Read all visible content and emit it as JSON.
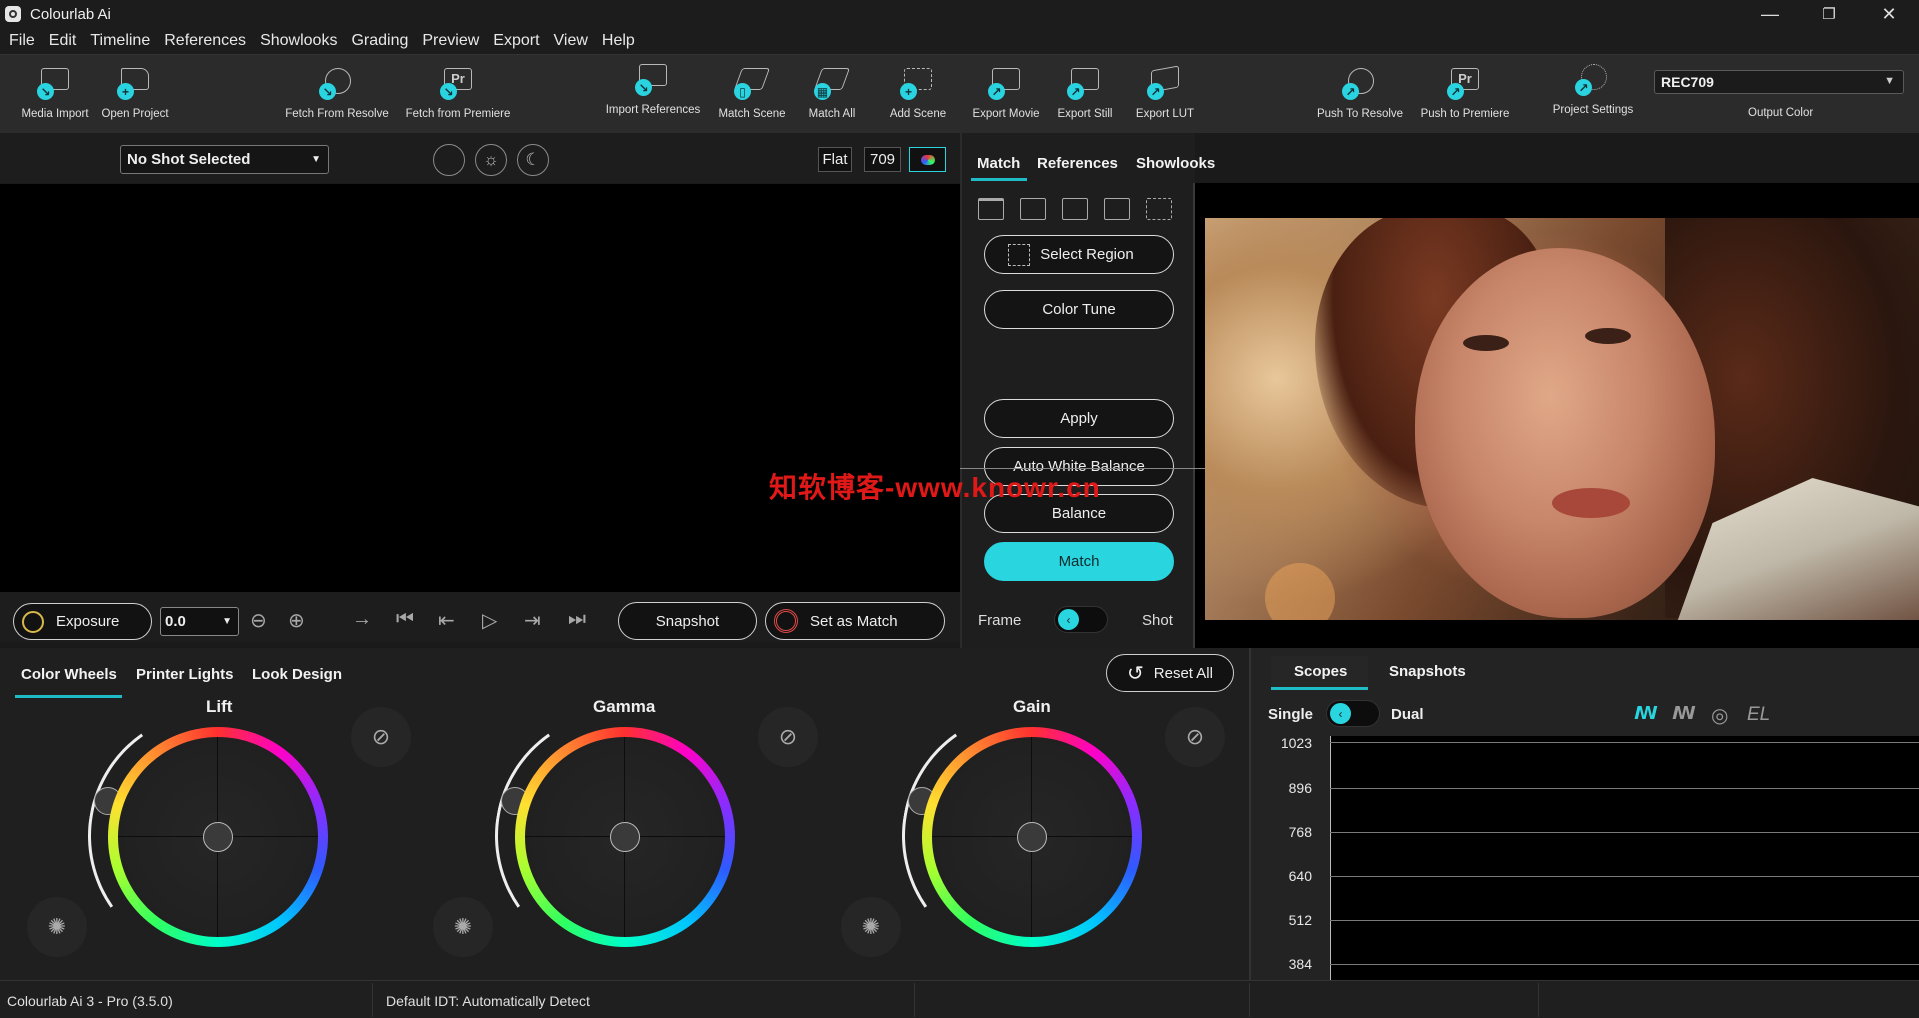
{
  "window": {
    "title": "Colourlab Ai",
    "minimize": "—",
    "maximize": "❐",
    "close": "✕"
  },
  "menu": [
    "File",
    "Edit",
    "Timeline",
    "References",
    "Showlooks",
    "Grading",
    "Preview",
    "Export",
    "View",
    "Help"
  ],
  "toolbar": {
    "media_import": "Media Import",
    "open_project": "Open Project",
    "fetch_resolve": "Fetch From Resolve",
    "fetch_premiere": "Fetch from Premiere",
    "import_references": "Import References",
    "match_scene": "Match Scene",
    "match_all": "Match All",
    "add_scene": "Add Scene",
    "export_movie": "Export Movie",
    "export_still": "Export Still",
    "export_lut": "Export LUT",
    "push_resolve": "Push To Resolve",
    "push_premiere": "Push to Premiere",
    "project_settings": "Project Settings",
    "output_color_value": "REC709",
    "output_color_label": "Output Color"
  },
  "viewer": {
    "shot_select": "No Shot Selected",
    "flat": "Flat",
    "gamma_709": "709",
    "exposure_label": "Exposure",
    "exposure_value": "0.0",
    "snapshot": "Snapshot",
    "set_as_match": "Set as Match"
  },
  "side_panel": {
    "tabs": [
      "Match",
      "References",
      "Showlooks"
    ],
    "select_region": "Select Region",
    "color_tune": "Color Tune",
    "apply": "Apply",
    "auto_white_balance": "Auto White Balance",
    "balance": "Balance",
    "match": "Match",
    "frame": "Frame",
    "shot": "Shot"
  },
  "grading": {
    "tabs": [
      "Color Wheels",
      "Printer Lights",
      "Look Design"
    ],
    "reset_all": "Reset All",
    "wheels": [
      "Lift",
      "Gamma",
      "Gain"
    ]
  },
  "scopes": {
    "tabs": [
      "Scopes",
      "Snapshots"
    ],
    "single": "Single",
    "dual": "Dual",
    "el": "EL",
    "y_ticks": [
      "1023",
      "896",
      "768",
      "640",
      "512",
      "384"
    ]
  },
  "status": {
    "version": "Colourlab Ai 3 - Pro (3.5.0)",
    "idt": "Default IDT: Automatically Detect"
  },
  "watermark": "知软博客-www.knowr.cn",
  "colors": {
    "accent": "#29d5df",
    "background": "#1a1a1a"
  }
}
